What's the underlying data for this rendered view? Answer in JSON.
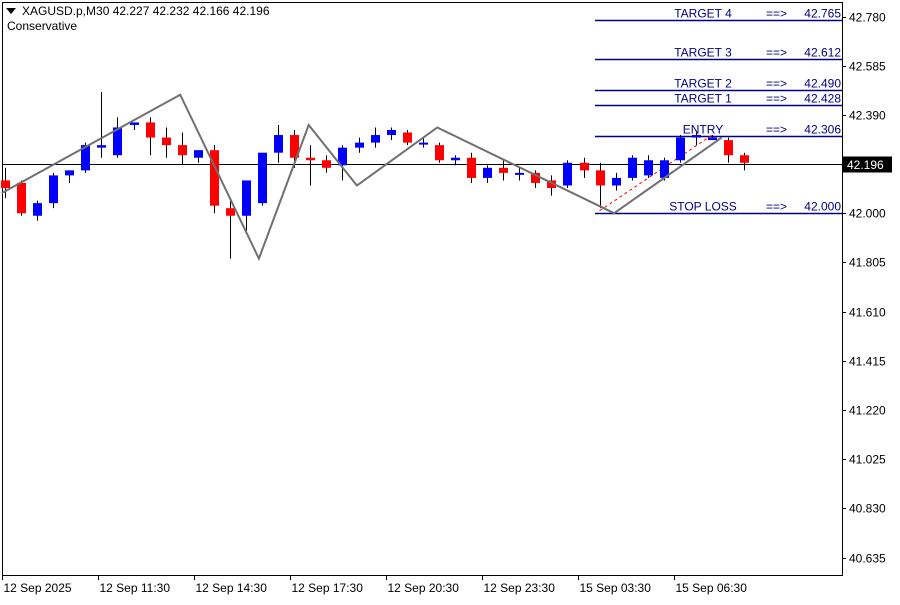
{
  "header": {
    "symbol_line": "XAGUSD.p,M30  42.227 42.232 42.166 42.196",
    "subtitle": "Conservative"
  },
  "colors": {
    "bull": "#0000ff",
    "bear": "#ff0000",
    "wick": "#000000",
    "level_line": "#000080",
    "level_text": "#000080",
    "zigzag": "#707070",
    "price_box_bg": "#000000",
    "price_box_fg": "#ffffff"
  },
  "chart_data": {
    "type": "candlestick",
    "symbol": "XAGUSD.p",
    "timeframe": "M30",
    "ylim": [
      40.55,
      42.83
    ],
    "y_ticks": [
      "42.780",
      "42.585",
      "42.390",
      "42.195",
      "42.000",
      "41.805",
      "41.610",
      "41.415",
      "41.220",
      "41.025",
      "40.830",
      "40.635"
    ],
    "x_ticks": [
      "12 Sep 2025",
      "12 Sep 11:30",
      "12 Sep 14:30",
      "12 Sep 17:30",
      "12 Sep 20:30",
      "12 Sep 23:30",
      "15 Sep 03:30",
      "15 Sep 06:30"
    ],
    "current_price": "42.196",
    "candles": [
      {
        "o": 42.13,
        "h": 42.18,
        "l": 42.06,
        "c": 42.1
      },
      {
        "o": 42.12,
        "h": 42.13,
        "l": 41.99,
        "c": 42.0
      },
      {
        "o": 41.99,
        "h": 42.05,
        "l": 41.97,
        "c": 42.04
      },
      {
        "o": 42.04,
        "h": 42.16,
        "l": 42.02,
        "c": 42.15
      },
      {
        "o": 42.15,
        "h": 42.17,
        "l": 42.12,
        "c": 42.17
      },
      {
        "o": 42.17,
        "h": 42.28,
        "l": 42.16,
        "c": 42.27
      },
      {
        "o": 42.26,
        "h": 42.48,
        "l": 42.22,
        "c": 42.27
      },
      {
        "o": 42.23,
        "h": 42.38,
        "l": 42.22,
        "c": 42.34
      },
      {
        "o": 42.35,
        "h": 42.36,
        "l": 42.33,
        "c": 42.36
      },
      {
        "o": 42.36,
        "h": 42.38,
        "l": 42.23,
        "c": 42.3
      },
      {
        "o": 42.3,
        "h": 42.34,
        "l": 42.22,
        "c": 42.27
      },
      {
        "o": 42.27,
        "h": 42.32,
        "l": 42.19,
        "c": 42.23
      },
      {
        "o": 42.22,
        "h": 42.25,
        "l": 42.2,
        "c": 42.25
      },
      {
        "o": 42.25,
        "h": 42.27,
        "l": 42.0,
        "c": 42.03
      },
      {
        "o": 42.02,
        "h": 42.05,
        "l": 41.82,
        "c": 41.99
      },
      {
        "o": 41.99,
        "h": 42.13,
        "l": 41.93,
        "c": 42.13
      },
      {
        "o": 42.04,
        "h": 42.21,
        "l": 42.03,
        "c": 42.24
      },
      {
        "o": 42.24,
        "h": 42.35,
        "l": 42.2,
        "c": 42.31
      },
      {
        "o": 42.31,
        "h": 42.33,
        "l": 42.18,
        "c": 42.22
      },
      {
        "o": 42.22,
        "h": 42.27,
        "l": 42.11,
        "c": 42.21
      },
      {
        "o": 42.21,
        "h": 42.23,
        "l": 42.16,
        "c": 42.18
      },
      {
        "o": 42.19,
        "h": 42.27,
        "l": 42.13,
        "c": 42.26
      },
      {
        "o": 42.26,
        "h": 42.3,
        "l": 42.24,
        "c": 42.28
      },
      {
        "o": 42.28,
        "h": 42.34,
        "l": 42.26,
        "c": 42.31
      },
      {
        "o": 42.31,
        "h": 42.34,
        "l": 42.29,
        "c": 42.33
      },
      {
        "o": 42.32,
        "h": 42.33,
        "l": 42.27,
        "c": 42.28
      },
      {
        "o": 42.28,
        "h": 42.3,
        "l": 42.26,
        "c": 42.28
      },
      {
        "o": 42.27,
        "h": 42.28,
        "l": 42.2,
        "c": 42.21
      },
      {
        "o": 42.21,
        "h": 42.23,
        "l": 42.19,
        "c": 42.22
      },
      {
        "o": 42.22,
        "h": 42.24,
        "l": 42.12,
        "c": 42.14
      },
      {
        "o": 42.14,
        "h": 42.19,
        "l": 42.12,
        "c": 42.18
      },
      {
        "o": 42.18,
        "h": 42.21,
        "l": 42.13,
        "c": 42.16
      },
      {
        "o": 42.16,
        "h": 42.18,
        "l": 42.13,
        "c": 42.16
      },
      {
        "o": 42.16,
        "h": 42.17,
        "l": 42.1,
        "c": 42.12
      },
      {
        "o": 42.13,
        "h": 42.15,
        "l": 42.07,
        "c": 42.1
      },
      {
        "o": 42.11,
        "h": 42.21,
        "l": 42.1,
        "c": 42.2
      },
      {
        "o": 42.2,
        "h": 42.22,
        "l": 42.14,
        "c": 42.17
      },
      {
        "o": 42.17,
        "h": 42.2,
        "l": 42.02,
        "c": 42.11
      },
      {
        "o": 42.11,
        "h": 42.16,
        "l": 42.09,
        "c": 42.14
      },
      {
        "o": 42.14,
        "h": 42.23,
        "l": 42.13,
        "c": 42.22
      },
      {
        "o": 42.15,
        "h": 42.23,
        "l": 42.14,
        "c": 42.21
      },
      {
        "o": 42.14,
        "h": 42.22,
        "l": 42.13,
        "c": 42.21
      },
      {
        "o": 42.21,
        "h": 42.31,
        "l": 42.2,
        "c": 42.3
      },
      {
        "o": 42.3,
        "h": 42.32,
        "l": 42.27,
        "c": 42.31
      },
      {
        "o": 42.29,
        "h": 42.31,
        "l": 42.29,
        "c": 42.3
      },
      {
        "o": 42.29,
        "h": 42.3,
        "l": 42.2,
        "c": 42.23
      },
      {
        "o": 42.23,
        "h": 42.24,
        "l": 42.17,
        "c": 42.2
      }
    ],
    "zigzag": [
      {
        "i": -0.2,
        "p": 42.08
      },
      {
        "i": 10.9,
        "p": 42.47
      },
      {
        "i": 15.8,
        "p": 41.82
      },
      {
        "i": 18.9,
        "p": 42.35
      },
      {
        "i": 21.9,
        "p": 42.11
      },
      {
        "i": 26.9,
        "p": 42.34
      },
      {
        "i": 37.9,
        "p": 42.0
      },
      {
        "i": 44.6,
        "p": 42.3
      }
    ],
    "entry_trend": {
      "from": {
        "i": 37.0,
        "p": 42.01
      },
      "to": {
        "i": 44.0,
        "p": 42.31
      }
    },
    "levels": [
      {
        "name": "TARGET 4",
        "arrow": "==>",
        "price": 42.765,
        "label": "42.765"
      },
      {
        "name": "TARGET 3",
        "arrow": "==>",
        "price": 42.612,
        "label": "42.612"
      },
      {
        "name": "TARGET 2",
        "arrow": "==>",
        "price": 42.49,
        "label": "42.490"
      },
      {
        "name": "TARGET 1",
        "arrow": "==>",
        "price": 42.428,
        "label": "42.428"
      },
      {
        "name": "ENTRY",
        "arrow": "==>",
        "price": 42.306,
        "label": "42.306"
      },
      {
        "name": "STOP LOSS",
        "arrow": "==>",
        "price": 42.0,
        "label": "42.000"
      }
    ]
  }
}
